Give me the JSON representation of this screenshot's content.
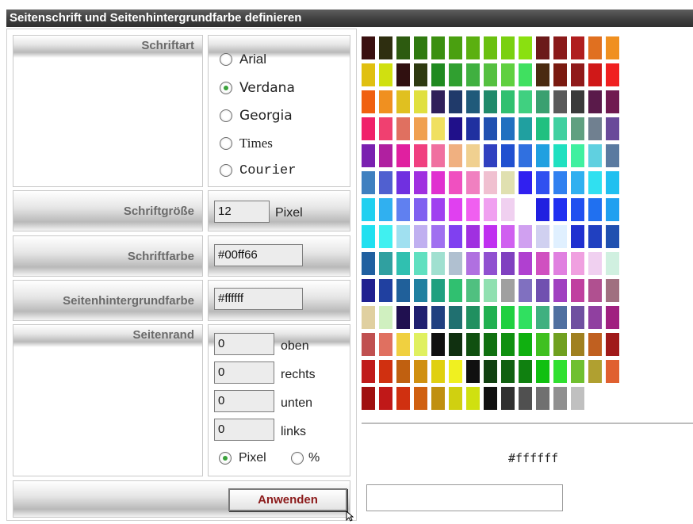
{
  "title": "Seitenschrift und Seitenhintergrundfarbe definieren",
  "font": {
    "label": "Schriftart",
    "options": [
      {
        "label": "Arial",
        "selected": false
      },
      {
        "label": "Verdana",
        "selected": true
      },
      {
        "label": "Georgia",
        "selected": false
      },
      {
        "label": "Times",
        "selected": false
      },
      {
        "label": "Courier",
        "selected": false
      }
    ]
  },
  "font_size": {
    "label": "Schriftgröße",
    "value": "12",
    "unit": "Pixel"
  },
  "font_color": {
    "label": "Schriftfarbe",
    "value": "#00ff66"
  },
  "background_color": {
    "label": "Seitenhintergrundfarbe",
    "value": "#ffffff"
  },
  "margin": {
    "label": "Seitenrand",
    "fields": [
      {
        "value": "0",
        "label": "oben"
      },
      {
        "value": "0",
        "label": "rechts"
      },
      {
        "value": "0",
        "label": "unten"
      },
      {
        "value": "0",
        "label": "links"
      }
    ],
    "units": [
      {
        "label": "Pixel",
        "selected": true
      },
      {
        "label": "%",
        "selected": false
      }
    ]
  },
  "apply_label": "Anwenden",
  "palette": {
    "rows": [
      [
        "#3a1010",
        "#2e2e10",
        "#2d5b10",
        "#2f7a10",
        "#3b8f10",
        "#4aa010",
        "#5bb010",
        "#6ac010",
        "#7ad010",
        "#8ae010",
        "#6b1a1a",
        "#8a1a1a",
        "#b01e1e",
        "#e07020",
        "#f09020"
      ],
      [
        "#e0c010",
        "#d0e010",
        "#301010",
        "#2e3a10",
        "#208a20",
        "#30a030",
        "#40b040",
        "#55c040",
        "#60d040",
        "#40e060",
        "#4a2a10",
        "#7a1a10",
        "#901a1a",
        "#d01818",
        "#f02020"
      ],
      [
        "#f06010",
        "#f09020",
        "#e0c020",
        "#e0e040",
        "#30205a",
        "#203a6a",
        "#205a7a",
        "#208a6a",
        "#30c070",
        "#40d080",
        "#3aa070",
        "#5a5a5a",
        "#3a3a3a",
        "#5a1a4a",
        "#701a50"
      ],
      [
        "#f0206a",
        "#f04070",
        "#e07060",
        "#f0a050",
        "#f0e060",
        "#20108a",
        "#2030a0",
        "#2050b0",
        "#2070c0",
        "#20a0a0",
        "#20c080",
        "#40d0a0",
        "#60a080",
        "#708090",
        "#6a4a9a"
      ],
      [
        "#7a20b0",
        "#b020a0",
        "#e020a0",
        "#f04080",
        "#f070a0",
        "#f0b080",
        "#f0d090",
        "#3040c0",
        "#2050d0",
        "#3070e0",
        "#20a0e0",
        "#20e0c0",
        "#40f0a0",
        "#60d0e0",
        "#5a7aa0"
      ],
      [
        "#4080c0",
        "#5060d0",
        "#7030e0",
        "#a030e0",
        "#e030d0",
        "#f050c0",
        "#f080c0",
        "#f0c0d0",
        "#e0e0b0",
        "#3020f0",
        "#3050f0",
        "#3080f0",
        "#30b0f0",
        "#30e0f0",
        "#20c0f0"
      ],
      [
        "#20d0f0",
        "#30b0f0",
        "#6080f0",
        "#8060f0",
        "#a040f0",
        "#e040f0",
        "#f060f0",
        "#f0a0f0",
        "#f0d0f0",
        "#ffffff",
        "#2020e0",
        "#2030f0",
        "#2050f0",
        "#2070f0",
        "#20a0f0"
      ],
      [
        "#20e0f0",
        "#40f0f0",
        "#a0e0f0",
        "#c0b0f0",
        "#a070f0",
        "#8040f0",
        "#a030e0",
        "#c030f0",
        "#d060f0",
        "#d0a0f0",
        "#d0d0f0",
        "#e0f0ff",
        "#2030d0",
        "#2040c0",
        "#2050b0"
      ],
      [
        "#2060a0",
        "#30a0a0",
        "#30c0b0",
        "#60e0c0",
        "#a0e0d0",
        "#b0c0d0",
        "#b070e0",
        "#9050d0",
        "#8040c0",
        "#b040d0",
        "#d050c0",
        "#e080e0",
        "#f0a0e0",
        "#f0d0f0",
        "#d0f0e0"
      ],
      [
        "#202090",
        "#2040a0",
        "#20609a",
        "#2080a0",
        "#20a080",
        "#30c070",
        "#50c080",
        "#90e0b0",
        "#a0a0a0",
        "#8070c0",
        "#7050b0",
        "#a040c0",
        "#c040a0",
        "#b05090",
        "#a07080"
      ],
      [
        "#e0d0a0",
        "#d0f0c0",
        "#201050",
        "#202070",
        "#204080",
        "#207070",
        "#209060",
        "#20b050",
        "#20d040",
        "#30e060",
        "#40b080",
        "#5070a0",
        "#7050a0",
        "#9040a0",
        "#a02080"
      ],
      [
        "#c05050",
        "#e07060",
        "#f0d040",
        "#e0f060",
        "#101010",
        "#103010",
        "#105010",
        "#107010",
        "#109010",
        "#10b010",
        "#40c020",
        "#70a020",
        "#a08020",
        "#c06020",
        "#a01a1a"
      ],
      [
        "#c01a1a",
        "#d03010",
        "#c06010",
        "#d09010",
        "#e0d010",
        "#f0f020",
        "#101010",
        "#104010",
        "#106010",
        "#108010",
        "#10c010",
        "#30e030",
        "#70c030",
        "#b0a030",
        "#e06030"
      ],
      [
        "#a01010",
        "#c01818",
        "#d03010",
        "#d06010",
        "#c09010",
        "#d0d010",
        "#d0e010",
        "#101010",
        "#303030",
        "#505050",
        "#707070",
        "#909090",
        "#c0c0c0"
      ]
    ]
  },
  "selected_hex": "#ffffff"
}
